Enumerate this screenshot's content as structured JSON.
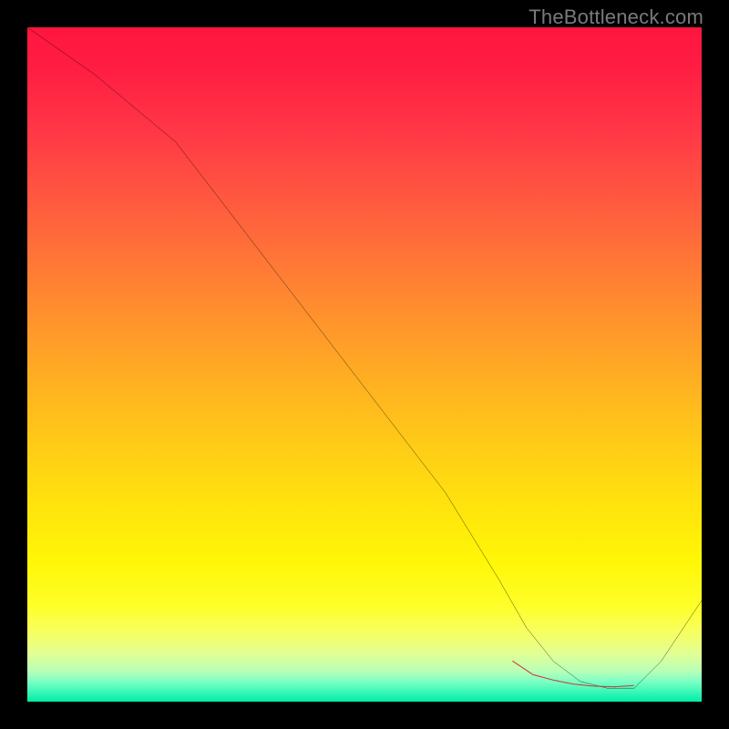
{
  "watermark": "TheBottleneck.com",
  "chart_data": {
    "type": "line",
    "title": "",
    "xlabel": "",
    "ylabel": "",
    "xlim": [
      0,
      100
    ],
    "ylim": [
      0,
      100
    ],
    "grid": false,
    "legend": false,
    "notes": "Background is a vertical red→orange→yellow→green gradient inside a black frame. A single black curve descends from top-left, flattens near the bottom around x≈72–90, then rises toward the right edge. A short red dashed segment highlights the flat minimum region along the curve.",
    "series": [
      {
        "name": "curve",
        "color": "#000000",
        "x": [
          0,
          10,
          22,
          32,
          42,
          52,
          62,
          70,
          74,
          78,
          82,
          86,
          90,
          94,
          98,
          100
        ],
        "y": [
          100,
          93,
          83,
          70,
          57,
          44,
          31,
          18,
          11,
          6,
          3,
          2,
          2,
          6,
          12,
          15
        ]
      },
      {
        "name": "highlight-min",
        "color": "#cc3a3a",
        "style": "dashed",
        "x": [
          72,
          75,
          78,
          81,
          84,
          87,
          90
        ],
        "y": [
          6,
          4,
          3.2,
          2.6,
          2.3,
          2.2,
          2.4
        ]
      }
    ]
  }
}
